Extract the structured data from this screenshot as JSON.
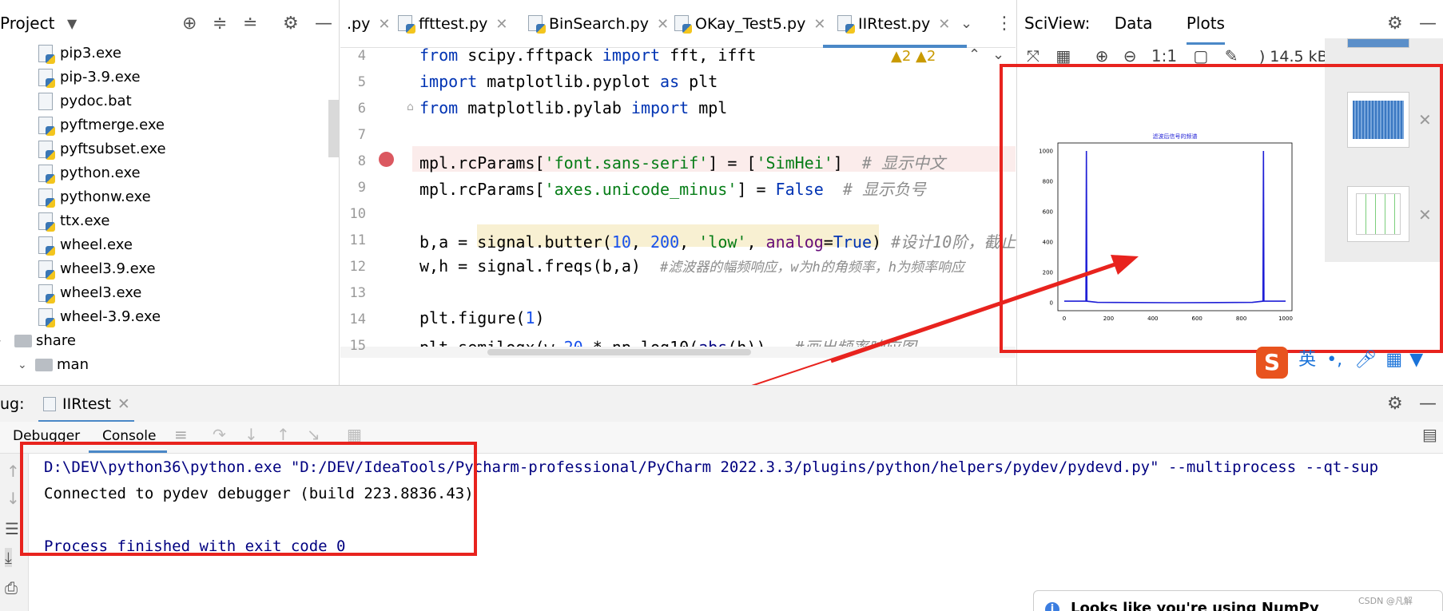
{
  "project": {
    "title": "Project",
    "tree": [
      {
        "label": "pip3.exe",
        "kind": "file"
      },
      {
        "label": "pip-3.9.exe",
        "kind": "file"
      },
      {
        "label": "pydoc.bat",
        "kind": "file"
      },
      {
        "label": "pyftmerge.exe",
        "kind": "file"
      },
      {
        "label": "pyftsubset.exe",
        "kind": "file"
      },
      {
        "label": "python.exe",
        "kind": "file"
      },
      {
        "label": "pythonw.exe",
        "kind": "file"
      },
      {
        "label": "ttx.exe",
        "kind": "file"
      },
      {
        "label": "wheel.exe",
        "kind": "file"
      },
      {
        "label": "wheel3.9.exe",
        "kind": "file"
      },
      {
        "label": "wheel3.exe",
        "kind": "file"
      },
      {
        "label": "wheel-3.9.exe",
        "kind": "file"
      },
      {
        "label": "share",
        "kind": "folder"
      },
      {
        "label": "man",
        "kind": "folder"
      }
    ]
  },
  "tabs": [
    {
      "label": ".py"
    },
    {
      "label": "ffttest.py"
    },
    {
      "label": "BinSearch.py"
    },
    {
      "label": "OKay_Test5.py"
    },
    {
      "label": "IIRtest.py"
    }
  ],
  "editor": {
    "warnings": "▲2  ▲2",
    "lines": [
      {
        "no": "4"
      },
      {
        "no": "5"
      },
      {
        "no": "6"
      },
      {
        "no": "7"
      },
      {
        "no": "8"
      },
      {
        "no": "9"
      },
      {
        "no": "10"
      },
      {
        "no": "11"
      },
      {
        "no": "12"
      },
      {
        "no": "13"
      },
      {
        "no": "14"
      },
      {
        "no": "15"
      }
    ],
    "code": {
      "l4a": "from",
      "l4b": " scipy.fftpack ",
      "l4c": "import",
      "l4d": " fft, ifft",
      "l5a": "import",
      "l5b": " matplotlib.pyplot ",
      "l5c": "as",
      "l5d": " plt",
      "l6a": "from",
      "l6b": " matplotlib.pylab ",
      "l6c": "import",
      "l6d": " mpl",
      "l8a": "mpl.rcParams[",
      "l8b": "'font.sans-serif'",
      "l8c": "] = [",
      "l8d": "'SimHei'",
      "l8e": "]  ",
      "l8f": "# 显示中文",
      "l9a": "mpl.rcParams[",
      "l9b": "'axes.unicode_minus'",
      "l9c": "] = ",
      "l9d": "False",
      "l9e": "  ",
      "l9f": "# 显示负号",
      "l11a": "b,a = signal.butter(",
      "l11b": "10",
      "l11c": ", ",
      "l11d": "200",
      "l11e": ", ",
      "l11f": "'low'",
      "l11g": ", ",
      "l11h": "analog",
      "l11i": "=",
      "l11j": "True",
      "l11k": ") ",
      "l11l": "#设计10阶，截止",
      "l12a": "w,h = signal.freqs(b,a)  ",
      "l12b": "#滤波器的幅频响应，w为h的角频率，h为频率响应",
      "l14a": "plt.figure(",
      "l14b": "1",
      "l14c": ")",
      "l15a": "plt.semilogx(w,",
      "l15b": "20",
      "l15c": " * np.log10(",
      "l15d": "abs",
      "l15e": "(h))   ",
      "l15f": "#画出频率响应图"
    }
  },
  "sciview": {
    "label": "SciView:",
    "tab_data": "Data",
    "tab_plots": "Plots",
    "size": ") 14.5 kB",
    "close": "✕"
  },
  "chart_data": {
    "type": "line",
    "title": "滤波后信号的频谱",
    "x": [
      0,
      98,
      100,
      102,
      150,
      500,
      850,
      898,
      900,
      902,
      1000
    ],
    "series": [
      {
        "values": [
          10,
          10,
          1000,
          10,
          2,
          0,
          2,
          10,
          1000,
          10,
          10
        ]
      }
    ],
    "xticks": [
      "0",
      "200",
      "400",
      "600",
      "800",
      "1000"
    ],
    "yticks": [
      "0",
      "200",
      "400",
      "600",
      "800",
      "1000"
    ],
    "xlim": [
      0,
      1000
    ],
    "ylim": [
      0,
      1000
    ],
    "color": "#1f1fd6"
  },
  "ime": {
    "label": "英"
  },
  "debug": {
    "label": "ug:",
    "run_tab": "IIRtest",
    "debugger_tab": "Debugger",
    "console_tab": "Console",
    "output": [
      "D:\\DEV\\python36\\python.exe \"D:/DEV/IdeaTools/Pycharm-professional/PyCharm 2022.3.3/plugins/python/helpers/pydev/pydevd.py\" --multiprocess --qt-sup",
      "Connected to pydev debugger (build 223.8836.43)",
      "",
      "Process finished with exit code 0"
    ]
  },
  "notification": {
    "text": "Looks like you're using NumPy"
  },
  "watermark": "CSDN @凡解",
  "colors": {
    "annotation_red": "#e8231e",
    "plot_line": "#1f1fd6",
    "keyword": "#0033b3",
    "string": "#067d17"
  }
}
